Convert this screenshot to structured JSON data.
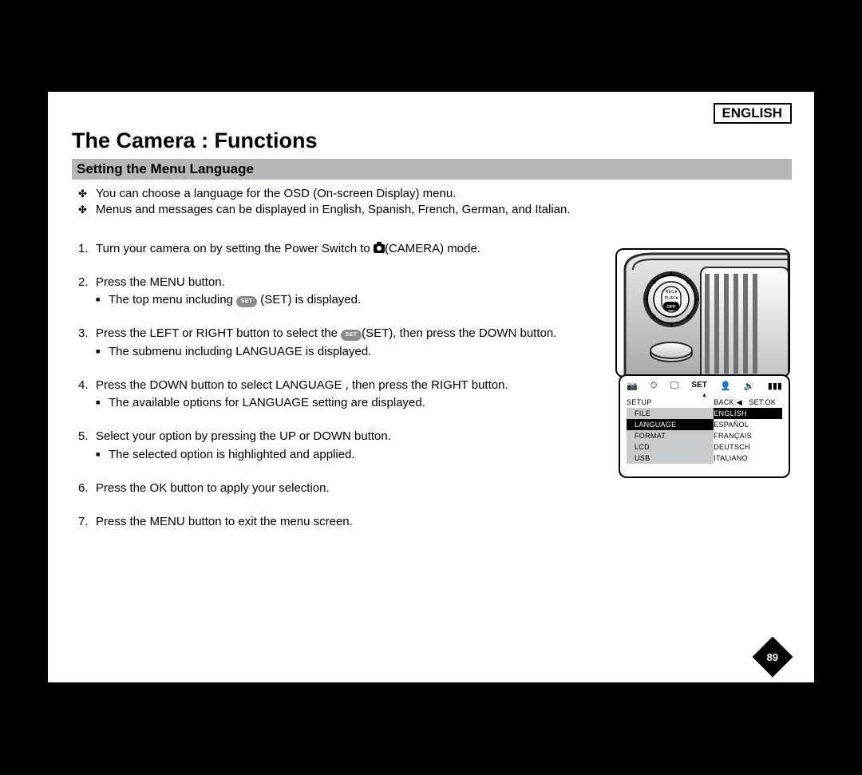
{
  "header": {
    "language_indicator": "ENGLISH",
    "title": "The Camera : Functions",
    "subtitle": "Setting the Menu Language"
  },
  "intro_bullets": [
    "You can choose a language for the OSD (On-screen Display) menu.",
    "Menus and messages can be displayed in English, Spanish, French, German, and Italian."
  ],
  "steps": [
    {
      "num": "1.",
      "pre": "Turn your camera on by setting the Power Switch to ",
      "icon": "camera-icon",
      "post": "(CAMERA) mode.",
      "subs": []
    },
    {
      "num": "2.",
      "pre": "Press the MENU button.",
      "subs": [
        {
          "pre": "The top menu including ",
          "icon": "set-oval",
          "post": " (SET) is displayed."
        }
      ]
    },
    {
      "num": "3.",
      "pre": "Press the LEFT or RIGHT button to select the ",
      "icon": "set-oval",
      "post": "(SET), then press the DOWN button.",
      "subs": [
        {
          "pre": "The submenu including  LANGUAGE  is displayed."
        }
      ]
    },
    {
      "num": "4.",
      "pre": "Press the DOWN button to select  LANGUAGE , then press the RIGHT button.",
      "subs": [
        {
          "pre": "The available options for LANGUAGE setting are displayed."
        }
      ]
    },
    {
      "num": "5.",
      "pre": "Select your option by pressing the UP or DOWN button.",
      "subs": [
        {
          "pre": "The selected option is highlighted and applied."
        }
      ]
    },
    {
      "num": "6.",
      "pre": "Press the OK button to apply your selection.",
      "subs": []
    },
    {
      "num": "7.",
      "pre": "Press the MENU button to exit the menu screen.",
      "subs": []
    }
  ],
  "osd": {
    "tabs": [
      "📷",
      "⏱",
      "🖵",
      "SET",
      "👤",
      "🔊",
      "▮▮▮"
    ],
    "set_label": "SET",
    "head_left": "SETUP",
    "head_back": "BACK:◀",
    "head_setok": "SET:OK",
    "rows": [
      {
        "left": "FILE",
        "right": "ENGLISH",
        "left_hl": "grey",
        "right_hl": "black"
      },
      {
        "left": "LANGUAGE",
        "right": "ESPAÑOL",
        "left_hl": "black"
      },
      {
        "left": "FORMAT",
        "right": "FRANÇAIS",
        "left_hl": "grey"
      },
      {
        "left": "LCD",
        "right": "DEUTSCH",
        "left_hl": "grey"
      },
      {
        "left": "USB",
        "right": "ITALIANO",
        "left_hl": "grey"
      }
    ]
  },
  "set_oval_text": "SET",
  "page_number": "89"
}
